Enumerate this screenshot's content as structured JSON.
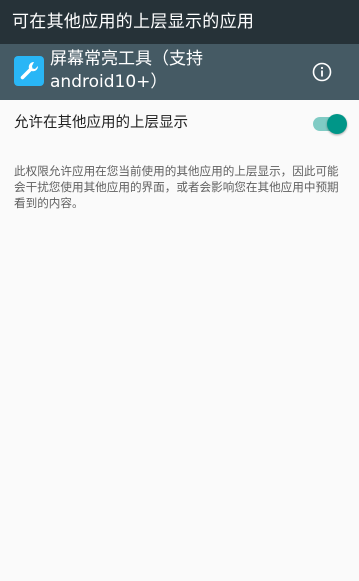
{
  "title_bar": {
    "title": "可在其他应用的上层显示的应用"
  },
  "app_header": {
    "app_name": "屏幕常亮工具（支持android10+）",
    "app_icon": "wrench-icon",
    "info_icon": "info-icon"
  },
  "setting": {
    "label": "允许在其他应用的上层显示",
    "enabled": true
  },
  "description": "此权限允许应用在您当前使用的其他应用的上层显示，因此可能会干扰您使用其他应用的界面，或者会影响您在其他应用中预期看到的内容。",
  "colors": {
    "status_bar_background": "#263238",
    "header_background": "#455a64",
    "app_icon_background": "#29b6f6",
    "switch_thumb": "#009688",
    "switch_track": "#80cbc4",
    "page_background": "#fafafa"
  }
}
